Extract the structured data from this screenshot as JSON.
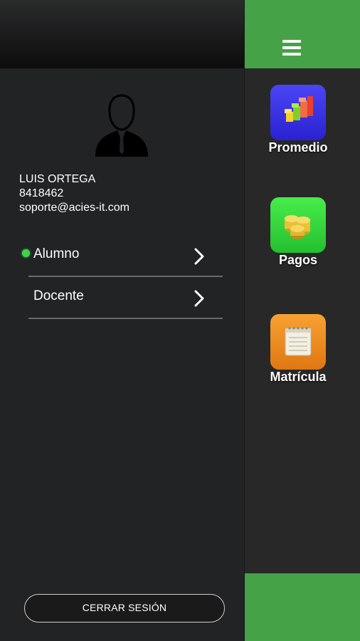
{
  "user": {
    "name": "LUIS ORTEGA",
    "id": "8418462",
    "email": "soporte@acies-it.com"
  },
  "menu": [
    {
      "label": "Alumno",
      "active": true
    },
    {
      "label": "Docente",
      "active": false
    }
  ],
  "logout_label": "CERRAR SESIÓN",
  "apps": [
    {
      "label": "Promedio",
      "icon": "bar-chart-icon",
      "color": "#3a33e8"
    },
    {
      "label": "Pagos",
      "icon": "coins-icon",
      "color": "#2fd43a"
    },
    {
      "label": "Matrícula",
      "icon": "notepad-icon",
      "color": "#f08a18"
    }
  ],
  "colors": {
    "accent": "#46a246",
    "active_dot": "#3fd44a"
  }
}
